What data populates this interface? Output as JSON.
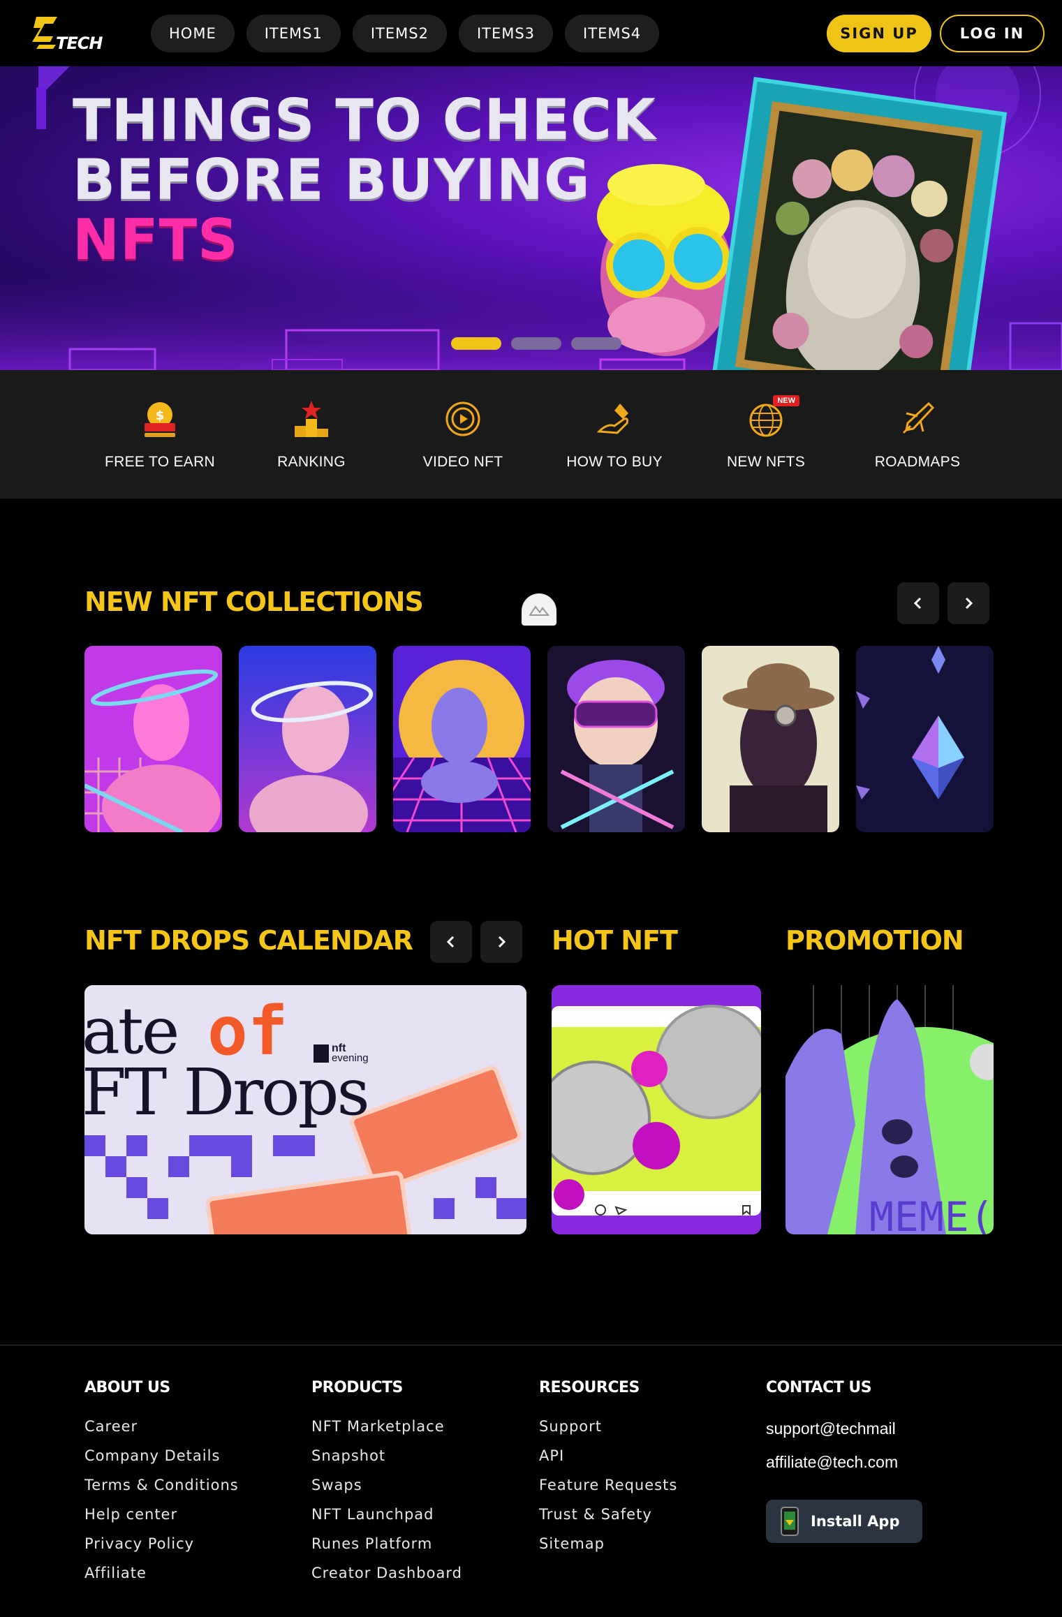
{
  "header": {
    "logo_text": "TECH",
    "nav": [
      "HOME",
      "ITEMS1",
      "ITEMS2",
      "ITEMS3",
      "ITEMS4"
    ],
    "signup_label": "SIGN UP",
    "login_label": "LOG IN"
  },
  "hero": {
    "line1": "THINGS TO CHECK",
    "line2": "BEFORE BUYING",
    "line3": "NFTS",
    "slides_total": 3,
    "active_slide": 1
  },
  "categories": [
    {
      "label": "FREE TO EARN",
      "icon": "cashback-coin-icon"
    },
    {
      "label": "RANKING",
      "icon": "ranking-podium-icon"
    },
    {
      "label": "VIDEO NFT",
      "icon": "play-circle-icon"
    },
    {
      "label": "HOW TO BUY",
      "icon": "hand-money-icon"
    },
    {
      "label": "NEW NFTS",
      "icon": "globe-new-icon",
      "badge": "NEW"
    },
    {
      "label": "ROADMAPS",
      "icon": "airplane-icon"
    }
  ],
  "collections": {
    "title": "NEW NFT COLLECTIONS",
    "cards": [
      {
        "image": "pink-statue-halo-art"
      },
      {
        "image": "blue-statue-ring-art"
      },
      {
        "image": "retro-venus-grid-art"
      },
      {
        "image": "cyber-kid-vr-art"
      },
      {
        "image": "hat-goggles-figure-art"
      },
      {
        "image": "crystal-diamond-art"
      }
    ]
  },
  "drops": {
    "title": "NFT DROPS CALENDAR",
    "image_text_1": "ate",
    "image_text_2": "of",
    "image_text_3": "FT Drops",
    "brand_top": "nft",
    "brand_bottom": "evening"
  },
  "hot": {
    "title": "HOT NFT"
  },
  "promotion": {
    "title": "PROMOTION",
    "image_text": "MEME("
  },
  "footer": {
    "about": {
      "title": "ABOUT US",
      "links": [
        "Career",
        "Company Details",
        "Terms & Conditions",
        "Help center",
        "Privacy Policy",
        "Affiliate"
      ]
    },
    "products": {
      "title": "PRODUCTS",
      "links": [
        "NFT Marketplace",
        "Snapshot",
        "Swaps",
        "NFT Launchpad",
        "Runes Platform",
        "Creator Dashboard"
      ]
    },
    "resources": {
      "title": "RESOURCES",
      "links": [
        "Support",
        "API",
        "Feature Requests",
        "Trust & Safety",
        "Sitemap"
      ]
    },
    "contact": {
      "title": "CONTACT US",
      "emails": [
        "support@techmail",
        "affiliate@tech.com"
      ],
      "install_label": "Install App"
    }
  },
  "colors": {
    "accent": "#f0c417",
    "pink": "#ff2ea8",
    "background": "#000000",
    "panel": "#1a1a1a"
  }
}
